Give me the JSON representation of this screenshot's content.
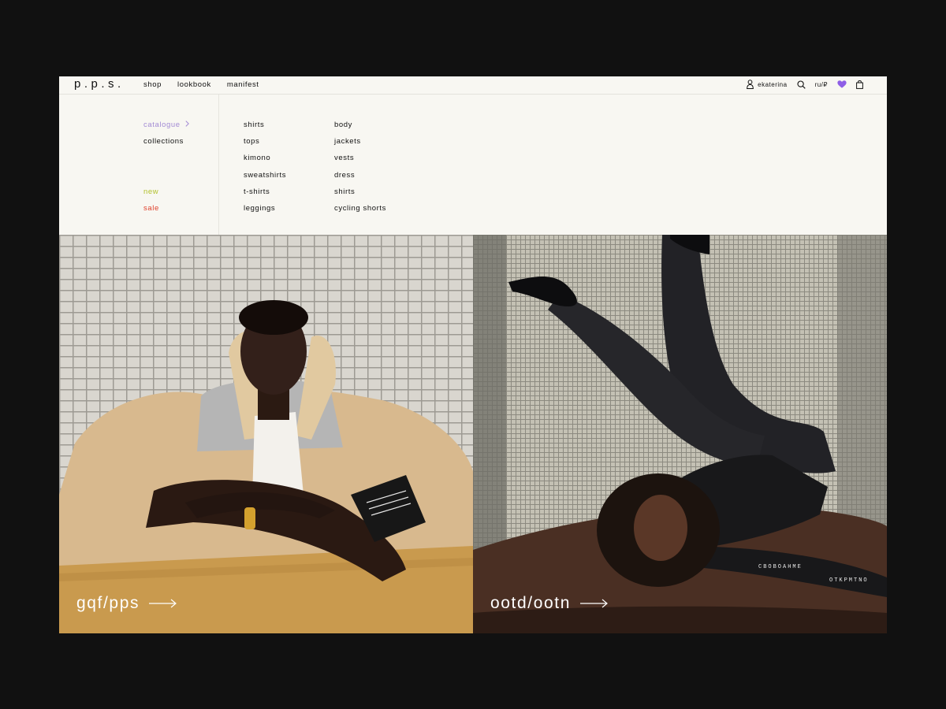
{
  "brand": {
    "logo": "p.p.s."
  },
  "nav": [
    {
      "label": "shop"
    },
    {
      "label": "lookbook"
    },
    {
      "label": "manifest"
    }
  ],
  "tools": {
    "user_name": "ekaterina",
    "locale": "ru/₽",
    "accent_heart": "#8e5ee6"
  },
  "menu": {
    "col_a": {
      "catalogue": "catalogue",
      "collections": "collections",
      "new": "new",
      "sale": "sale"
    },
    "col_b": [
      "shirts",
      "tops",
      "kimono",
      "sweatshirts",
      "t-shirts",
      "leggings"
    ],
    "col_c": [
      "body",
      "jackets",
      "vests",
      "dress",
      "shirts",
      "cycling shorts"
    ],
    "colors": {
      "catalogue": "#a38bd4",
      "new": "#b3c22e",
      "sale": "#e0412c"
    }
  },
  "hero": {
    "left": {
      "label": "gqf/pps"
    },
    "right": {
      "label": "ootd/ootn"
    }
  }
}
